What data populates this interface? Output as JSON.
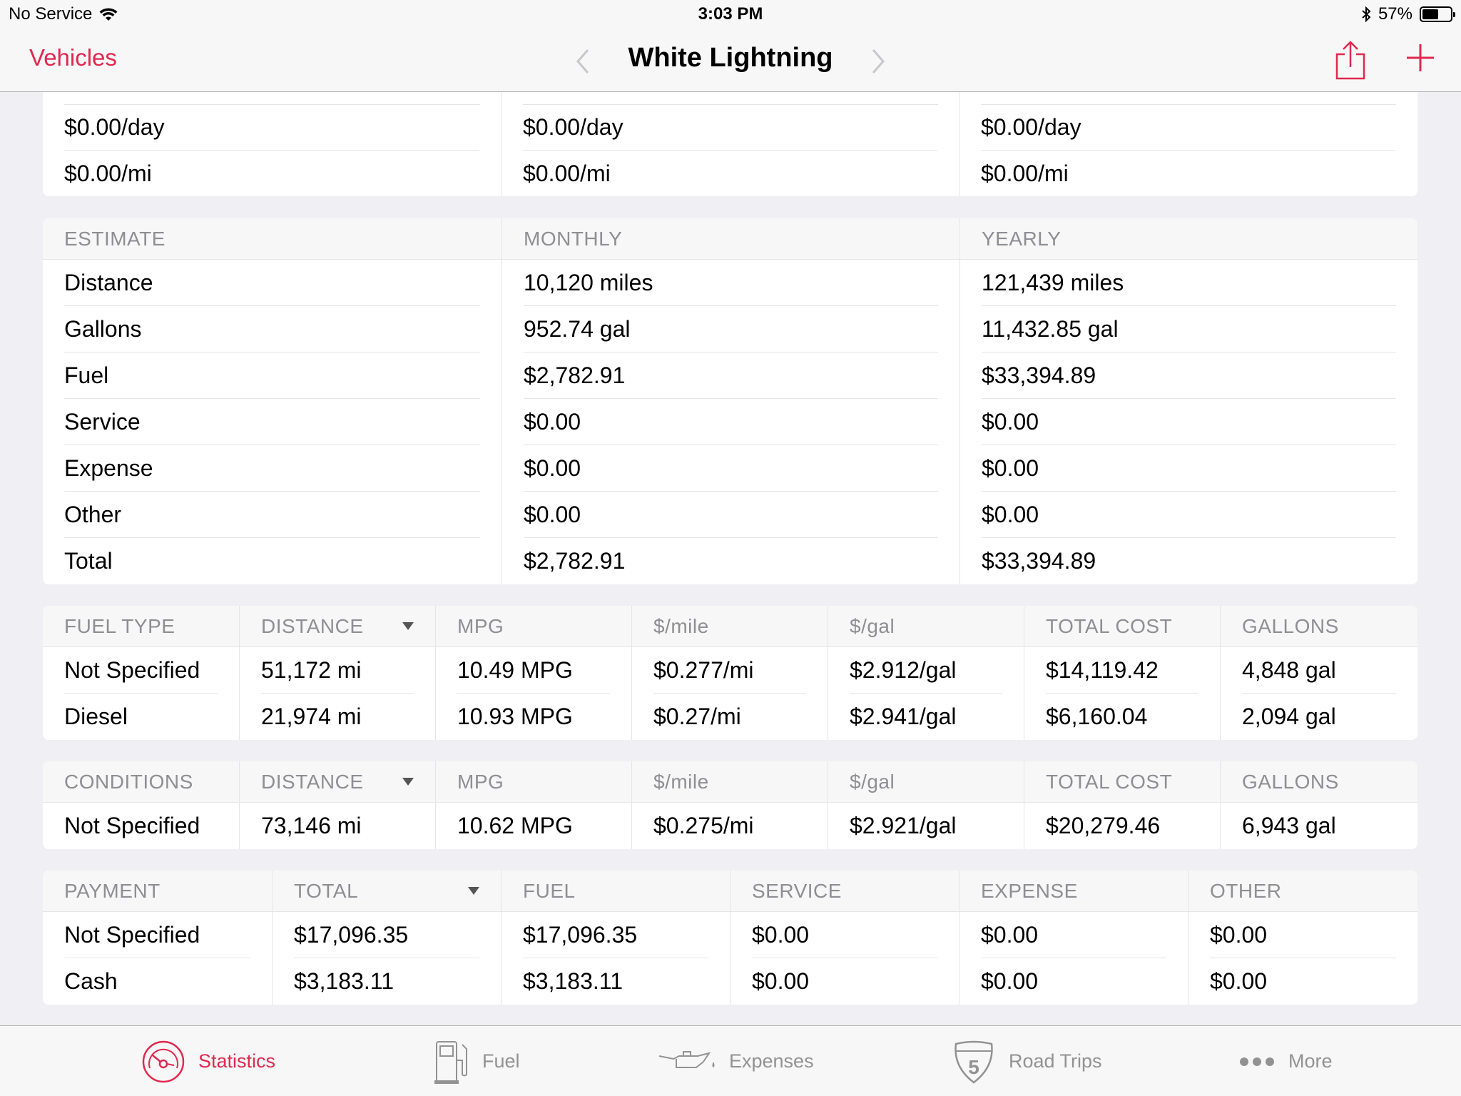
{
  "status_bar": {
    "carrier": "No Service",
    "time": "3:03 PM",
    "battery": "57%",
    "battery_level": 0.57
  },
  "nav": {
    "back_label": "Vehicles",
    "title": "White Lightning"
  },
  "top_card": {
    "columns": [
      {
        "per_day": "$0.00/day",
        "per_mile": "$0.00/mi"
      },
      {
        "per_day": "$0.00/day",
        "per_mile": "$0.00/mi"
      },
      {
        "per_day": "$0.00/day",
        "per_mile": "$0.00/mi"
      }
    ]
  },
  "estimate": {
    "headers": [
      "ESTIMATE",
      "MONTHLY",
      "YEARLY"
    ],
    "rows": [
      {
        "label": "Distance",
        "monthly": "10,120 miles",
        "yearly": "121,439 miles"
      },
      {
        "label": "Gallons",
        "monthly": "952.74 gal",
        "yearly": "11,432.85 gal"
      },
      {
        "label": "Fuel",
        "monthly": "$2,782.91",
        "yearly": "$33,394.89"
      },
      {
        "label": "Service",
        "monthly": "$0.00",
        "yearly": "$0.00"
      },
      {
        "label": "Expense",
        "monthly": "$0.00",
        "yearly": "$0.00"
      },
      {
        "label": "Other",
        "monthly": "$0.00",
        "yearly": "$0.00"
      },
      {
        "label": "Total",
        "monthly": "$2,782.91",
        "yearly": "$33,394.89"
      }
    ]
  },
  "fuel_type": {
    "headers": [
      "FUEL TYPE",
      "DISTANCE",
      "MPG",
      "$/mile",
      "$/gal",
      "TOTAL COST",
      "GALLONS"
    ],
    "rows": [
      [
        "Not Specified",
        "51,172 mi",
        "10.49 MPG",
        "$0.277/mi",
        "$2.912/gal",
        "$14,119.42",
        "4,848 gal"
      ],
      [
        "Diesel",
        "21,974 mi",
        "10.93 MPG",
        "$0.27/mi",
        "$2.941/gal",
        "$6,160.04",
        "2,094 gal"
      ]
    ]
  },
  "conditions": {
    "headers": [
      "CONDITIONS",
      "DISTANCE",
      "MPG",
      "$/mile",
      "$/gal",
      "TOTAL COST",
      "GALLONS"
    ],
    "rows": [
      [
        "Not Specified",
        "73,146 mi",
        "10.62 MPG",
        "$0.275/mi",
        "$2.921/gal",
        "$20,279.46",
        "6,943 gal"
      ]
    ]
  },
  "payment": {
    "headers": [
      "PAYMENT",
      "TOTAL",
      "FUEL",
      "SERVICE",
      "EXPENSE",
      "OTHER"
    ],
    "rows": [
      [
        "Not Specified",
        "$17,096.35",
        "$17,096.35",
        "$0.00",
        "$0.00",
        "$0.00"
      ],
      [
        "Cash",
        "$3,183.11",
        "$3,183.11",
        "$0.00",
        "$0.00",
        "$0.00"
      ]
    ]
  },
  "tabs": [
    {
      "label": "Statistics",
      "icon": "gauge-icon"
    },
    {
      "label": "Fuel",
      "icon": "fuel-pump-icon"
    },
    {
      "label": "Expenses",
      "icon": "oil-can-icon"
    },
    {
      "label": "Road Trips",
      "icon": "interstate-shield-icon",
      "shield_number": "5"
    },
    {
      "label": "More",
      "icon": "more-dots-icon"
    }
  ],
  "colors": {
    "accent": "#e0284f",
    "inactive": "#929292",
    "header_text": "#8e8e93"
  }
}
